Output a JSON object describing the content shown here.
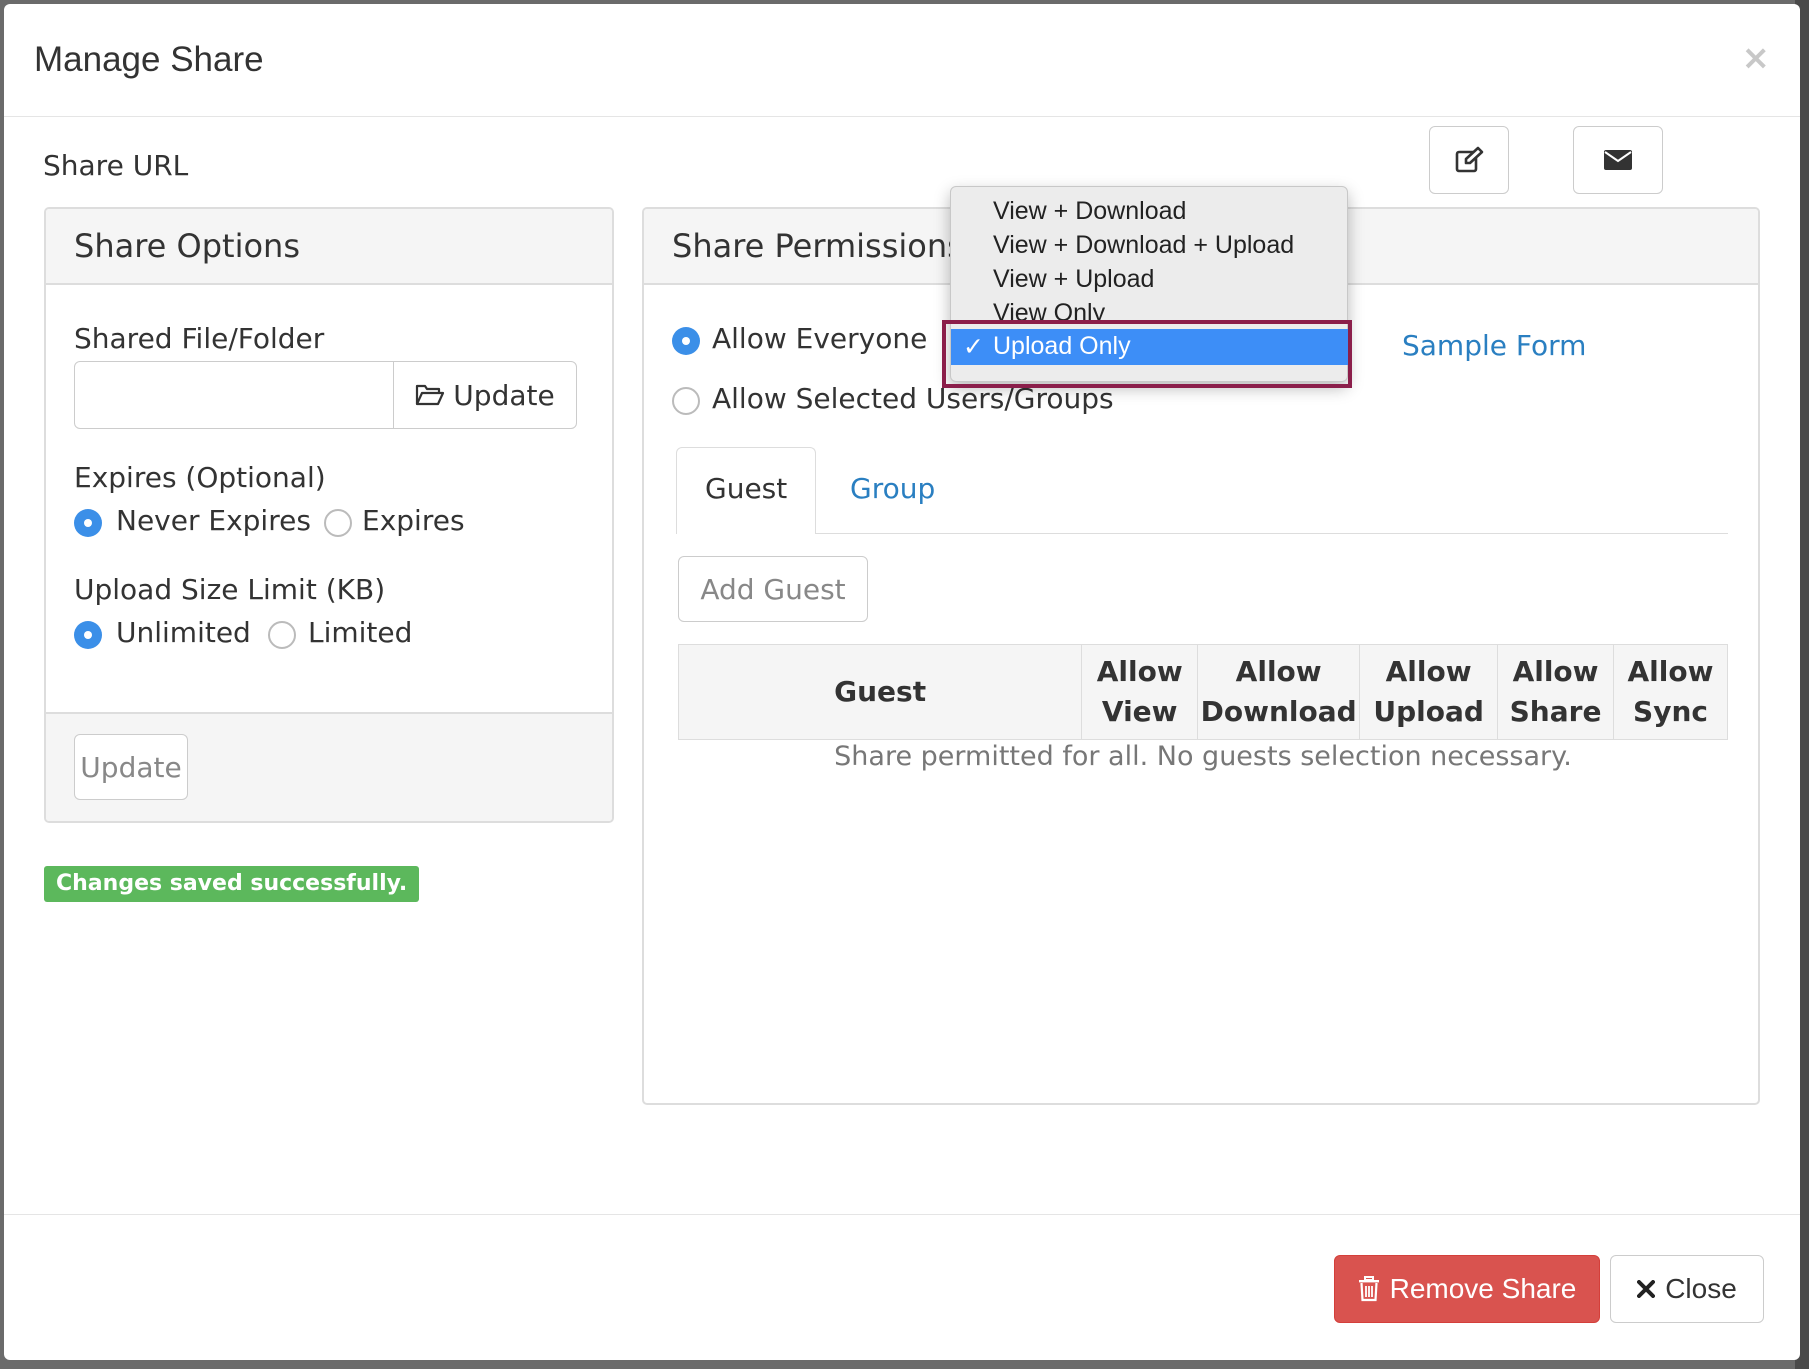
{
  "modal": {
    "title": "Manage Share",
    "close_glyph": "×",
    "share_url_label": "Share URL",
    "edit_icon": "edit-icon",
    "email_icon": "envelope-icon"
  },
  "share_options": {
    "heading": "Share Options",
    "shared_file_label": "Shared File/Folder",
    "shared_file_value": "",
    "update_inline_label": "Update",
    "expires_label": "Expires (Optional)",
    "expires_options": [
      "Never Expires",
      "Expires"
    ],
    "expires_selected": "Never Expires",
    "upload_limit_label": "Upload Size Limit (KB)",
    "upload_limit_options": [
      "Unlimited",
      "Limited"
    ],
    "upload_limit_selected": "Unlimited",
    "update_footer_label": "Update"
  },
  "status": {
    "message": "Changes saved successfully.",
    "color": "#5cb85c"
  },
  "share_permissions": {
    "heading": "Share Permissions",
    "allow_everyone": "Allow Everyone",
    "allow_selected": "Allow Selected Users/Groups",
    "selected_option": "Allow Everyone",
    "sample_form_link": "Sample Form",
    "tabs": [
      "Guest",
      "Group"
    ],
    "active_tab": "Guest",
    "add_guest_label": "Add Guest",
    "table_headers": [
      [
        "Guest"
      ],
      [
        "Allow",
        "View"
      ],
      [
        "Allow",
        "Download"
      ],
      [
        "Allow",
        "Upload"
      ],
      [
        "Allow",
        "Share"
      ],
      [
        "Allow",
        "Sync"
      ]
    ],
    "empty_message": "Share permitted for all. No guests selection necessary."
  },
  "permission_dropdown": {
    "options": [
      "View + Download",
      "View + Download + Upload",
      "View + Upload",
      "View Only",
      "Upload Only"
    ],
    "selected": "Upload Only",
    "check_glyph": "✓",
    "selection_color": "#3d8ef7",
    "highlight_color": "#8b1e4a"
  },
  "footer": {
    "remove_share_label": "Remove Share",
    "remove_icon": "trash-icon",
    "close_label": "Close",
    "close_icon": "times-icon",
    "danger_color": "#d9534f"
  }
}
